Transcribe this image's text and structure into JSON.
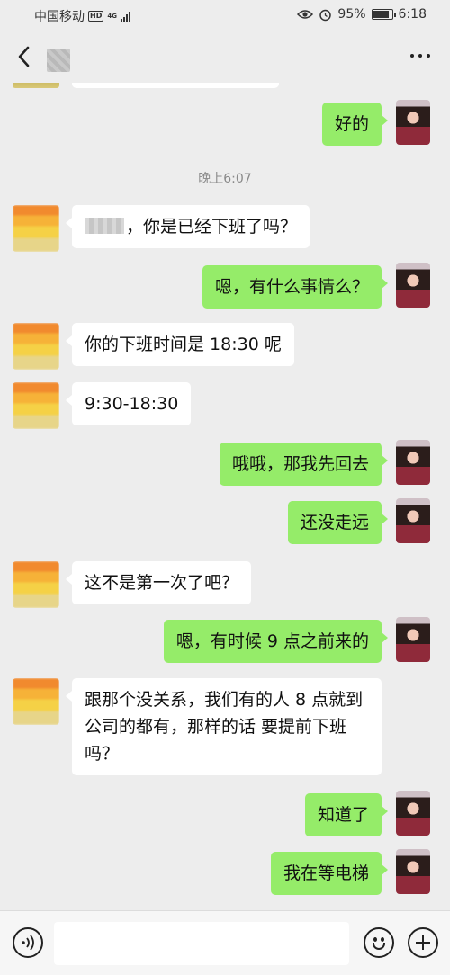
{
  "status_bar": {
    "carrier": "中国移动",
    "hd": "HD",
    "network": "4G",
    "battery": "95%",
    "time": "6:18",
    "icons": [
      "signal-icon",
      "eye-icon",
      "alarm-icon",
      "battery-icon"
    ]
  },
  "header": {
    "back_icon": "chevron-left-icon",
    "more_icon": "more-dots-icon"
  },
  "messages": [
    {
      "side": "right",
      "text": "好的"
    },
    {
      "type": "time",
      "text": "晚上6:07"
    },
    {
      "side": "left",
      "text": "，你是已经下班了吗？"
    },
    {
      "side": "right",
      "text": "嗯，有什么事情么？"
    },
    {
      "side": "left",
      "text": "你的下班时间是 18:30 呢"
    },
    {
      "side": "left",
      "text": "9:30-18:30"
    },
    {
      "side": "right",
      "text": "哦哦，那我先回去"
    },
    {
      "side": "right",
      "text": "还没走远"
    },
    {
      "side": "left",
      "text": "这不是第一次了吧？"
    },
    {
      "side": "right",
      "text": "嗯，有时候 9 点之前来的"
    },
    {
      "side": "left",
      "text": "跟那个没关系，我们有的人 8 点就到公司的都有，那样的话 要提前下班吗？"
    },
    {
      "side": "right",
      "text": "知道了"
    },
    {
      "side": "right",
      "text": "我在等电梯"
    }
  ],
  "input_bar": {
    "voice_icon": "voice-icon",
    "text_value": "",
    "emoji_icon": "emoji-icon",
    "plus_icon": "plus-icon"
  },
  "colors": {
    "background": "#ededed",
    "self_bubble": "#95ec69",
    "other_bubble": "#ffffff"
  }
}
